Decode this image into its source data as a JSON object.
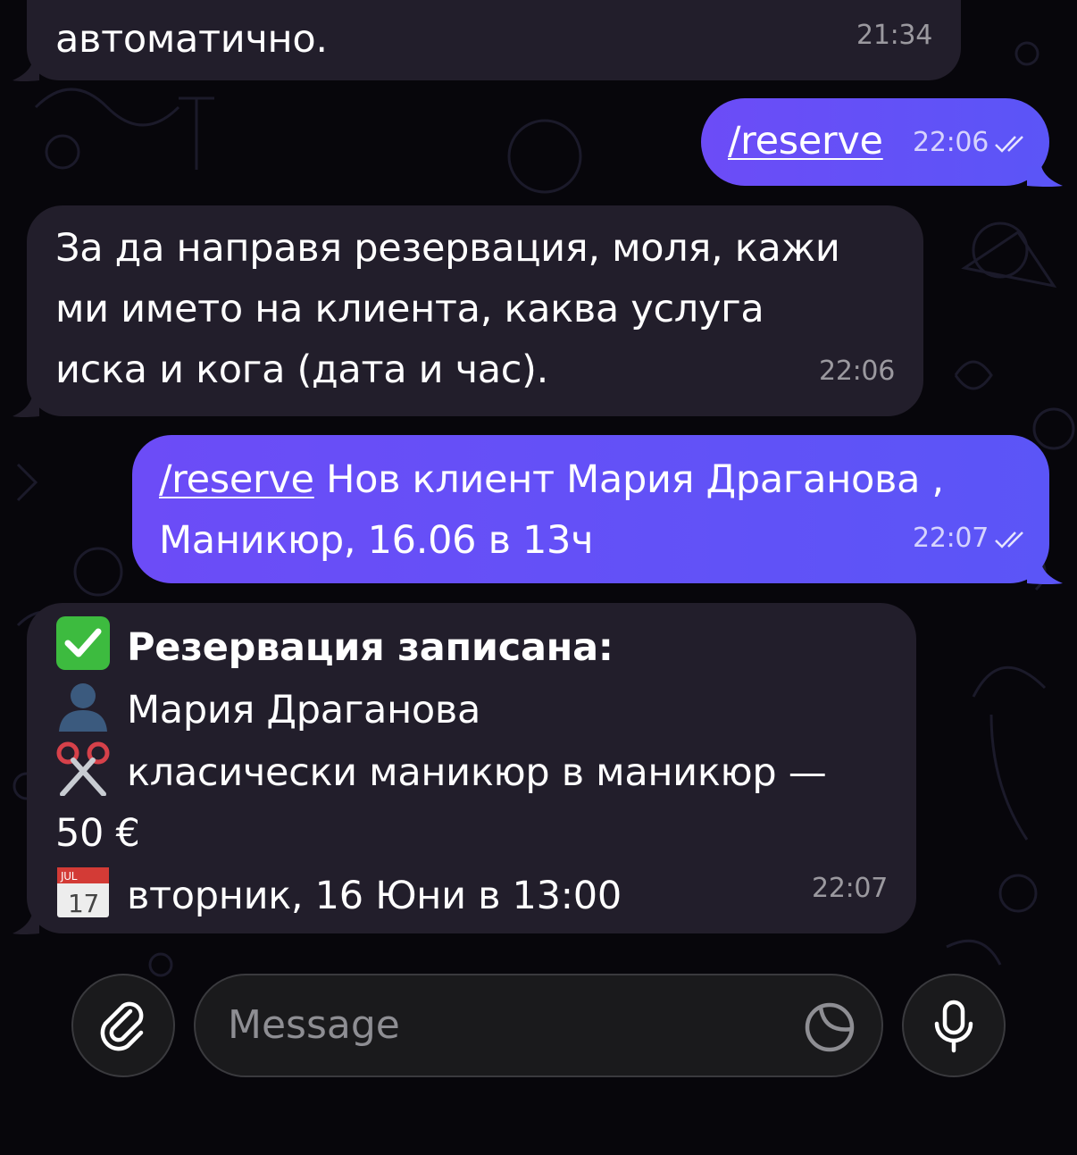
{
  "messages": [
    {
      "direction": "in",
      "lines": [
        "автоматично."
      ],
      "time": "21:34"
    },
    {
      "direction": "out",
      "command": "/reserve",
      "time": "22:06",
      "status": "read"
    },
    {
      "direction": "in",
      "lines": [
        "За да направя резервация, моля, кажи",
        "ми името на клиента, каква услуга",
        "иска и кога (дата и час)."
      ],
      "time": "22:06"
    },
    {
      "direction": "out",
      "command": "/reserve",
      "text_rest": " Нов клиент Мария Драганова ,",
      "line2": "Маникюр, 16.06 в 13ч",
      "time": "22:07",
      "status": "read"
    },
    {
      "direction": "in",
      "heading": "Резервация записана:",
      "name": "Мария Драганова",
      "service_line1": "класически маникюр в маникюр —",
      "service_line2": "50 €",
      "datetime": "вторник, 16 Юни в 13:00",
      "calendar_month": "JUL",
      "calendar_day": "17",
      "time": "22:07",
      "icons": [
        "check-mark-button-icon",
        "person-silhouette-icon",
        "scissors-icon",
        "calendar-icon"
      ]
    }
  ],
  "composer": {
    "placeholder": "Message"
  },
  "colors": {
    "incoming": "#221e2b",
    "outgoing_start": "#6c4cf7",
    "outgoing_end": "#5b55f7",
    "background": "#07060b"
  }
}
